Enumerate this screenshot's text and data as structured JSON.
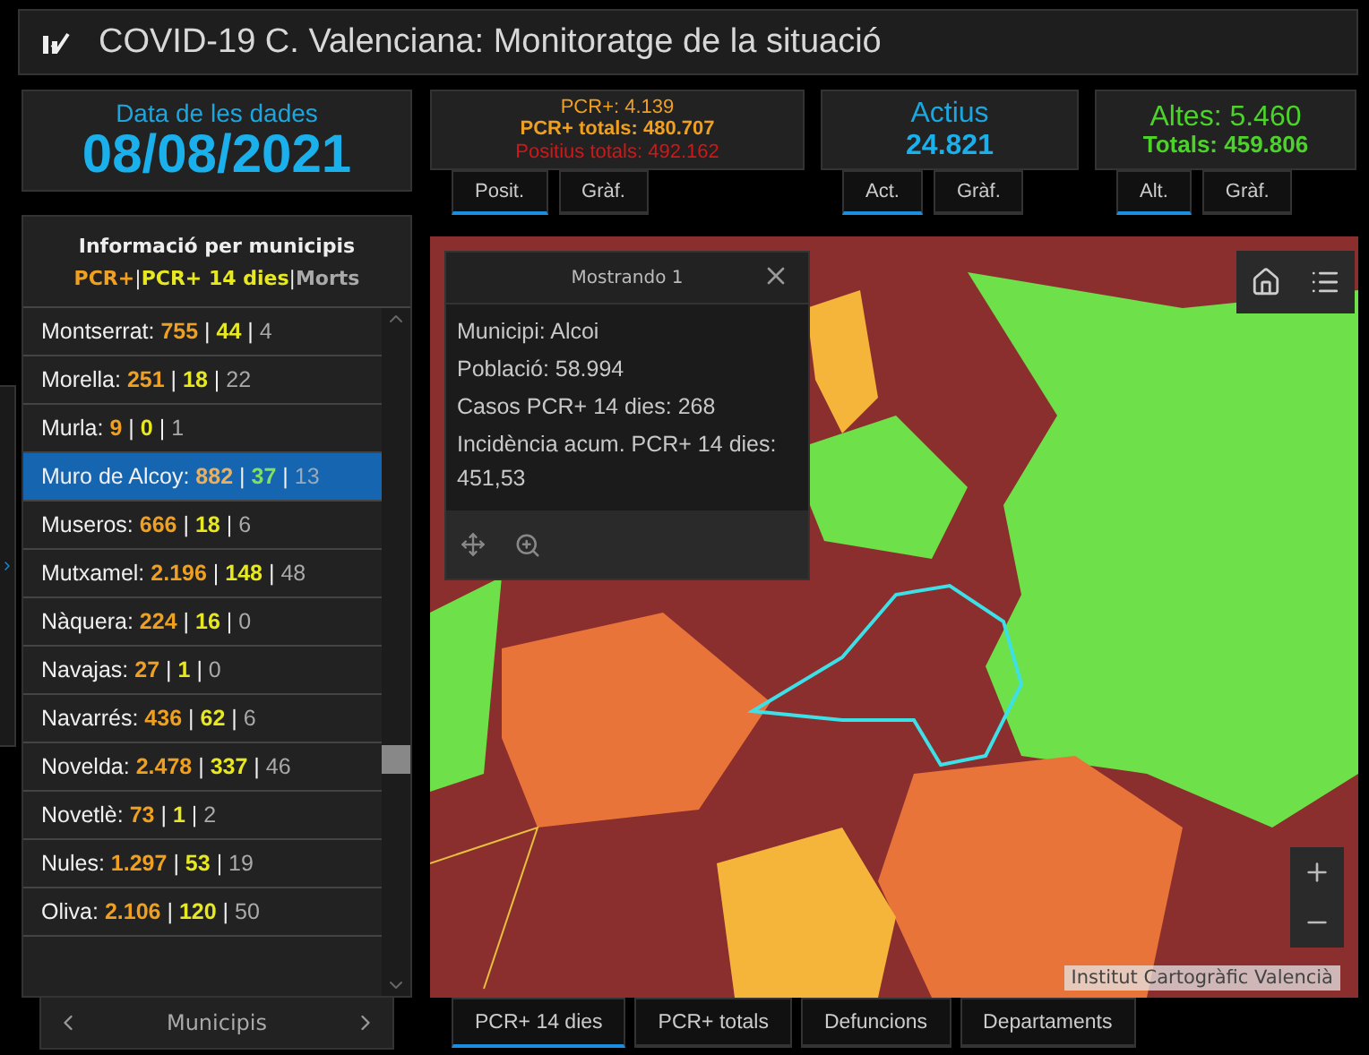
{
  "header": {
    "title": "COVID-19 C. Valenciana: Monitoratge de la situació"
  },
  "date_card": {
    "label": "Data de les dades",
    "value": "08/08/2021"
  },
  "cards": [
    {
      "lines": [
        {
          "kind": "pcr",
          "text": "PCR+: 4.139"
        },
        {
          "kind": "pcr_total",
          "text": "PCR+ totals: 480.707"
        },
        {
          "kind": "positius",
          "text": "Positius totals: 492.162"
        }
      ],
      "tabs": [
        {
          "label": "Posit.",
          "selected": true
        },
        {
          "label": "Gràf.",
          "selected": false
        }
      ]
    },
    {
      "lines": [
        {
          "kind": "title_blue",
          "text": "Actius"
        },
        {
          "kind": "value_blue",
          "text": "24.821"
        }
      ],
      "tabs": [
        {
          "label": "Act.",
          "selected": true
        },
        {
          "label": "Gràf.",
          "selected": false
        }
      ]
    },
    {
      "lines": [
        {
          "kind": "title_green",
          "text": "Altes: 5.460"
        },
        {
          "kind": "value_green",
          "text": "Totals: 459.806"
        }
      ],
      "tabs": [
        {
          "label": "Alt.",
          "selected": true
        },
        {
          "label": "Gràf.",
          "selected": false
        }
      ]
    }
  ],
  "municipalities": {
    "title": "Informació per municipis",
    "legend": [
      {
        "kind": "pcr",
        "text": "PCR+"
      },
      {
        "kind": "sep",
        "text": "|"
      },
      {
        "kind": "pcr14",
        "text": "PCR+ 14 dies"
      },
      {
        "kind": "sep",
        "text": "|"
      },
      {
        "kind": "deaths",
        "text": "Morts"
      }
    ],
    "separator": "|",
    "rows": [
      {
        "name": "Montserrat:",
        "pcr": "755",
        "pcr14": "44",
        "deaths": "4",
        "selected": false
      },
      {
        "name": "Morella:",
        "pcr": "251",
        "pcr14": "18",
        "deaths": "22",
        "selected": false
      },
      {
        "name": "Murla:",
        "pcr": "9",
        "pcr14": "0",
        "deaths": "1",
        "selected": false
      },
      {
        "name": "Muro de Alcoy:",
        "pcr": "882",
        "pcr14": "37",
        "deaths": "13",
        "selected": true
      },
      {
        "name": "Museros:",
        "pcr": "666",
        "pcr14": "18",
        "deaths": "6",
        "selected": false
      },
      {
        "name": "Mutxamel:",
        "pcr": "2.196",
        "pcr14": "148",
        "deaths": "48",
        "selected": false
      },
      {
        "name": "Nàquera:",
        "pcr": "224",
        "pcr14": "16",
        "deaths": "0",
        "selected": false
      },
      {
        "name": "Navajas:",
        "pcr": "27",
        "pcr14": "1",
        "deaths": "0",
        "selected": false
      },
      {
        "name": "Navarrés:",
        "pcr": "436",
        "pcr14": "62",
        "deaths": "6",
        "selected": false
      },
      {
        "name": "Novelda:",
        "pcr": "2.478",
        "pcr14": "337",
        "deaths": "46",
        "selected": false
      },
      {
        "name": "Novetlè:",
        "pcr": "73",
        "pcr14": "1",
        "deaths": "2",
        "selected": false
      },
      {
        "name": "Nules:",
        "pcr": "1.297",
        "pcr14": "53",
        "deaths": "19",
        "selected": false
      },
      {
        "name": "Oliva:",
        "pcr": "2.106",
        "pcr14": "120",
        "deaths": "50",
        "selected": false
      }
    ],
    "nav_label": "Municipis"
  },
  "popup": {
    "title": "Mostrando 1",
    "fields": [
      "Municipi: Alcoi",
      "Població: 58.994",
      "Casos PCR+ 14 dies: 268",
      "Incidència acum. PCR+ 14 dies: 451,53"
    ]
  },
  "map": {
    "attribution": "Institut Cartogràfic Valencià"
  },
  "bottom_tabs": [
    {
      "label": "PCR+ 14 dies",
      "selected": true
    },
    {
      "label": "PCR+ totals",
      "selected": false
    },
    {
      "label": "Defuncions",
      "selected": false
    },
    {
      "label": "Departaments",
      "selected": false
    }
  ]
}
